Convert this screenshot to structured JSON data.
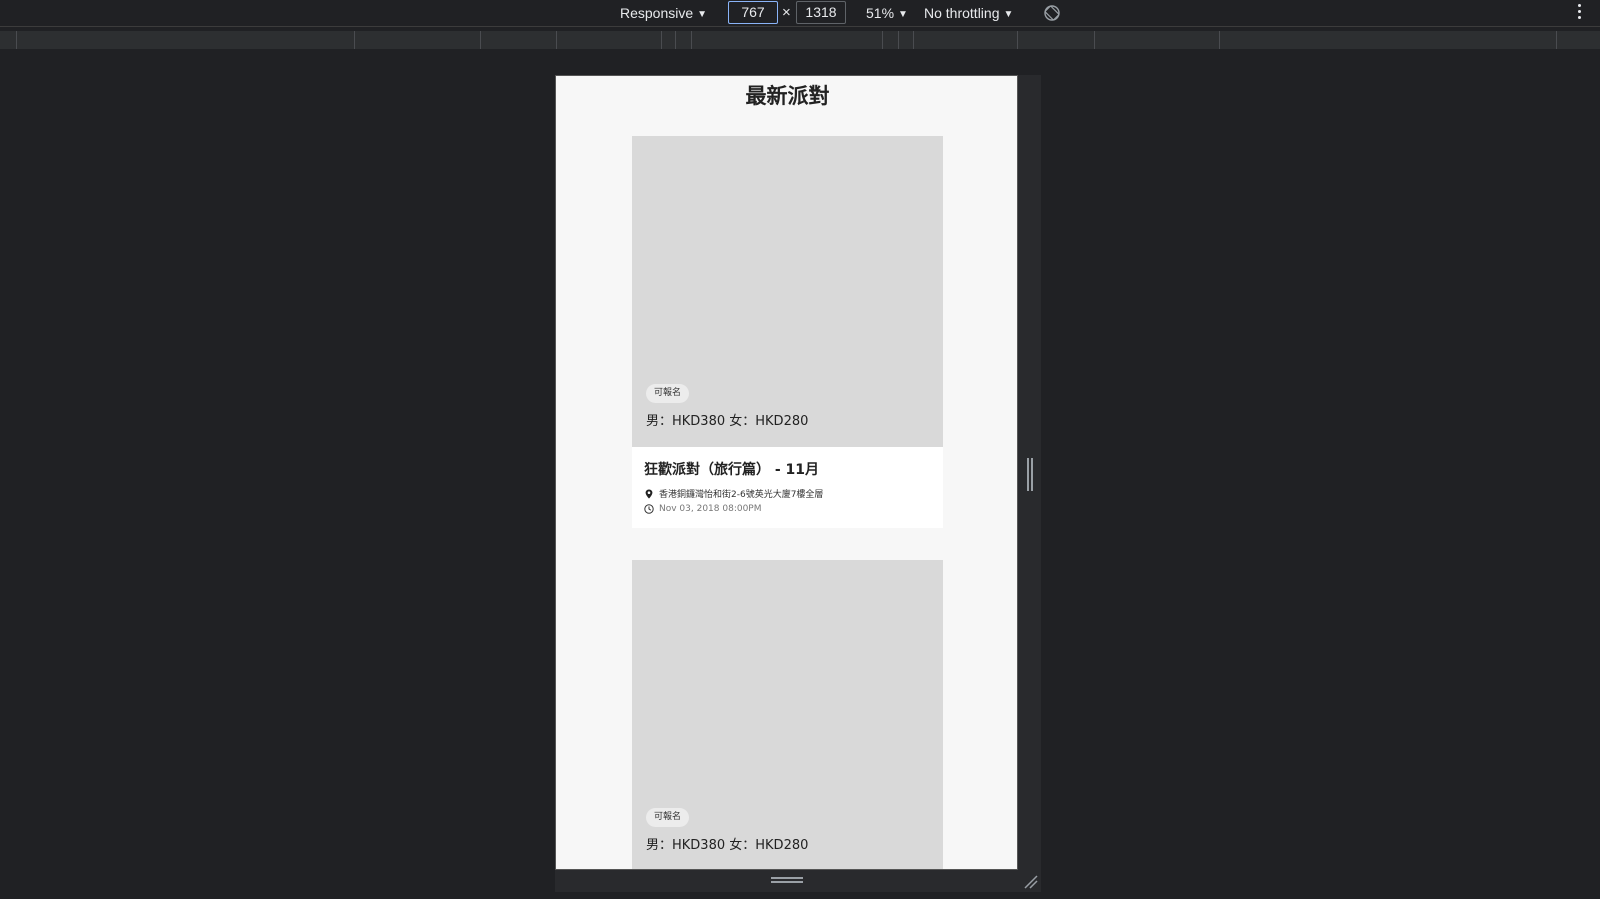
{
  "toolbar": {
    "device_mode": "Responsive",
    "width_value": "767",
    "times": "×",
    "height_value": "1318",
    "zoom": "51%",
    "throttling": "No throttling"
  },
  "page": {
    "title": "最新派對"
  },
  "cards": [
    {
      "status": "可報名",
      "price": "男：HKD380 女：HKD280",
      "title": "狂歡派對（旅行篇） - 11月",
      "address": "香港銅鑼灣怡和街2-6號英光大廈7樓全層",
      "datetime": "Nov 03, 2018 08:00PM"
    },
    {
      "status": "可報名",
      "price": "男：HKD380 女：HKD280"
    }
  ],
  "colors": {
    "devtools_bg": "#202124",
    "page_bg": "#f7f7f7",
    "image_placeholder": "#d9d9d9",
    "active_input_border": "#8ab4f8"
  }
}
